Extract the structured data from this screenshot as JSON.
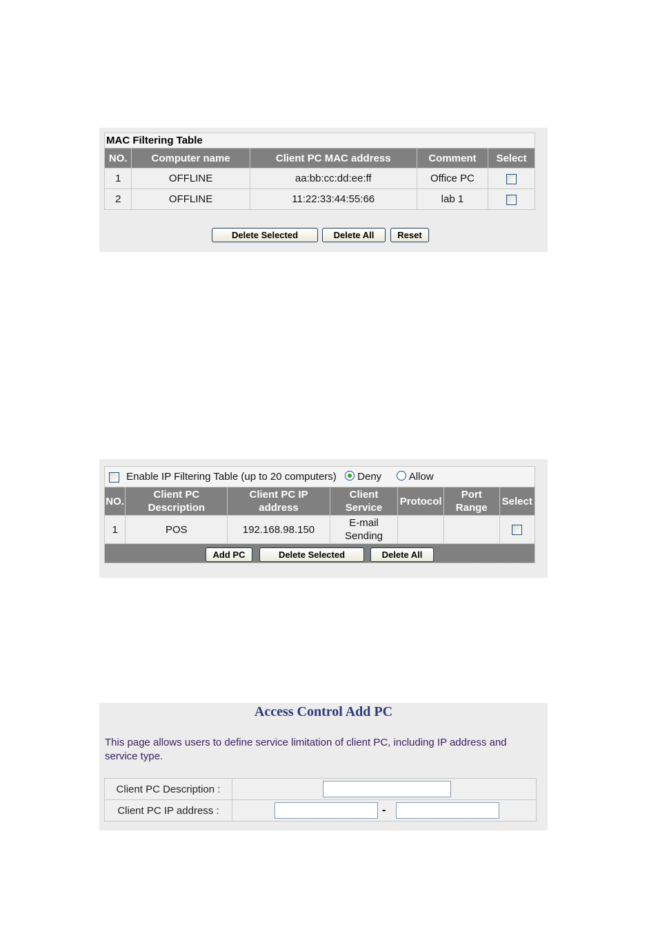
{
  "mac_table": {
    "caption": "MAC Filtering Table",
    "headers": [
      "NO.",
      "Computer name",
      "Client PC MAC address",
      "Comment",
      "Select"
    ],
    "rows": [
      {
        "no": "1",
        "name": "OFFLINE",
        "mac": "aa:bb:cc:dd:ee:ff",
        "comment": "Office PC",
        "selected": false
      },
      {
        "no": "2",
        "name": "OFFLINE",
        "mac": "11:22:33:44:55:66",
        "comment": "lab 1",
        "selected": false
      }
    ],
    "buttons": {
      "delete_selected": "Delete Selected",
      "delete_all": "Delete All",
      "reset": "Reset"
    }
  },
  "ip_table": {
    "enable_label": "Enable IP Filtering Table (up to 20 computers)",
    "enabled": false,
    "mode_options": [
      "Deny",
      "Allow"
    ],
    "mode_selected": "Deny",
    "headers": [
      "NO.",
      "Client PC Description",
      "Client PC IP address",
      "Client Service",
      "Protocol",
      "Port Range",
      "Select"
    ],
    "header_lines": [
      [
        "NO."
      ],
      [
        "Client PC",
        "Description"
      ],
      [
        "Client PC IP",
        "address"
      ],
      [
        "Client",
        "Service"
      ],
      [
        "Protocol"
      ],
      [
        "Port",
        "Range"
      ],
      [
        "Select"
      ]
    ],
    "rows": [
      {
        "no": "1",
        "description": "POS",
        "ip": "192.168.98.150",
        "service_line1": "E-mail",
        "service_line2": "Sending",
        "protocol": "",
        "port_range": "",
        "selected": false
      }
    ],
    "buttons": {
      "add_pc": "Add PC",
      "delete_selected": "Delete Selected",
      "delete_all": "Delete All"
    }
  },
  "add_pc": {
    "title": "Access Control Add PC",
    "description": "This page allows users to define service limitation of client PC, including IP address and service type.",
    "fields": {
      "description_label": "Client PC Description :",
      "description_value": "",
      "ip_label": "Client PC IP address :",
      "ip_start_value": "",
      "ip_separator": "-",
      "ip_end_value": ""
    }
  }
}
